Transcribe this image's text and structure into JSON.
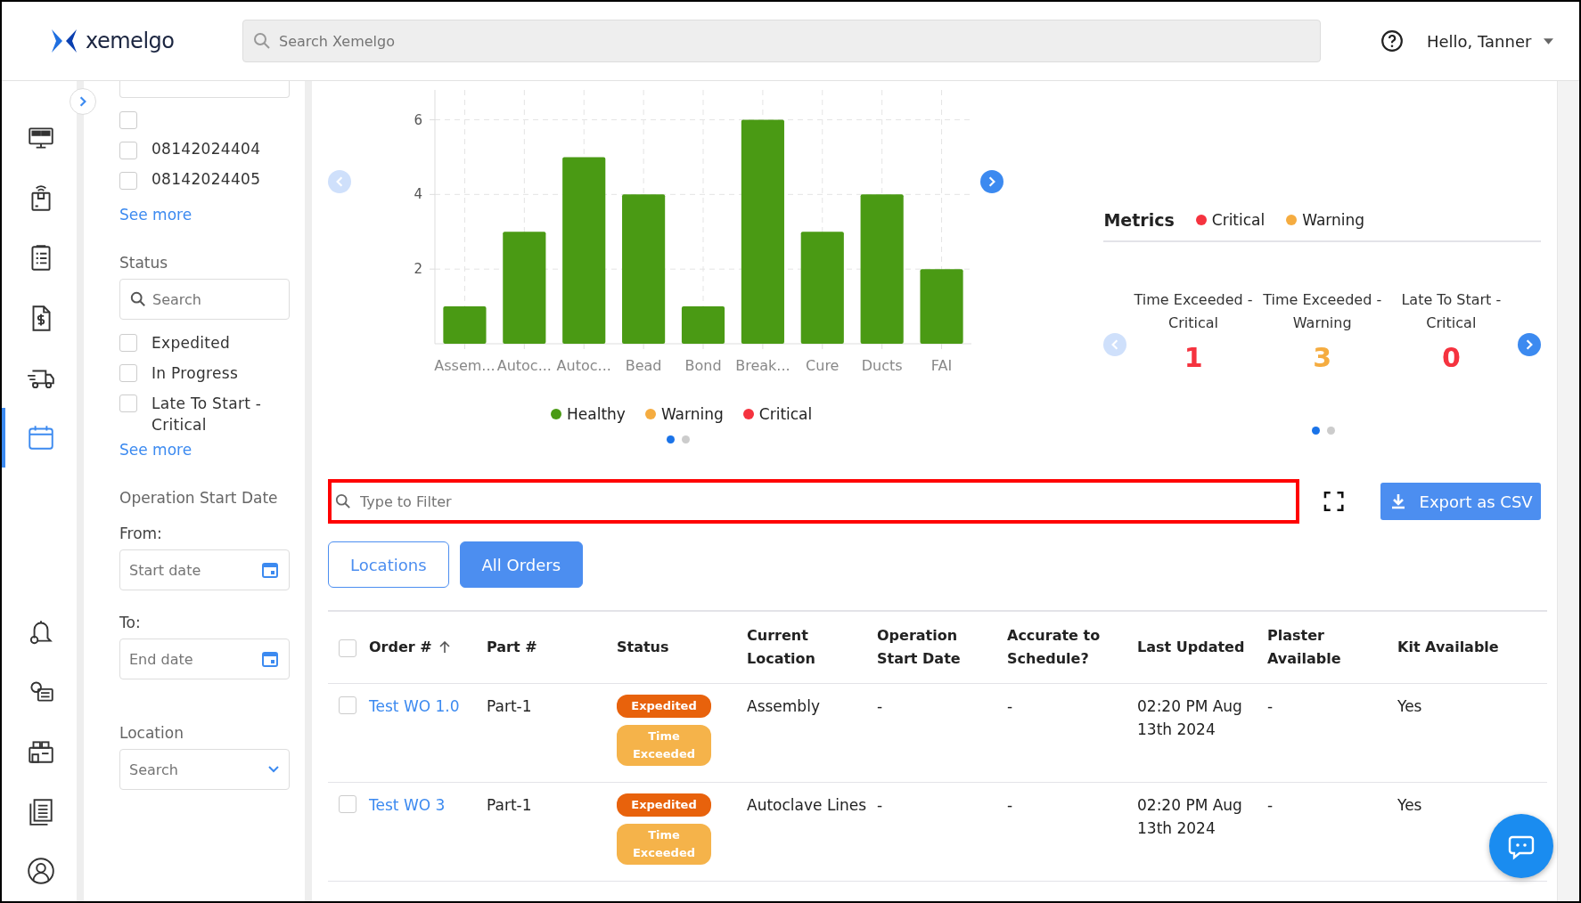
{
  "header": {
    "logo": "xemelgo",
    "search": {
      "placeholder": "Search Xemelgo"
    },
    "greeting": "Hello, Tanner"
  },
  "nav": [
    {
      "selected": false
    },
    {
      "selected": false
    },
    {
      "selected": false
    },
    {
      "selected": false
    },
    {
      "selected": false
    },
    {
      "selected": true
    },
    {
      "selected": false
    },
    {
      "selected": false
    },
    {
      "selected": false
    },
    {
      "selected": false
    },
    {
      "selected": false
    }
  ],
  "filters": {
    "order_options": [
      {
        "checked": false
      },
      {
        "label": "08142024404",
        "checked": false
      },
      {
        "label": "08142024405",
        "checked": false
      }
    ],
    "order_see_more": "See more",
    "status": {
      "title": "Status",
      "search_placeholder": "Search",
      "options": [
        {
          "label": "Expedited",
          "checked": false
        },
        {
          "label": "In Progress",
          "checked": false
        },
        {
          "label": "Late To Start - Critical",
          "checked": false
        }
      ],
      "see_more": "See more"
    },
    "date": {
      "title": "Operation Start Date",
      "from_label": "From:",
      "from_placeholder": "Start date",
      "to_label": "To:",
      "to_placeholder": "End date"
    },
    "location": {
      "title": "Location",
      "placeholder": "Search"
    }
  },
  "chart": {
    "chart_data": {
      "type": "bar",
      "grid": true,
      "categories": [
        "Assem...",
        "Autoc...",
        "Autoc...",
        "Bead",
        "Bond",
        "Break...",
        "Cure",
        "Ducts",
        "FAI"
      ],
      "series": [
        {
          "name": "Healthy",
          "color": "#4a9a14",
          "values": [
            1,
            3,
            5,
            4,
            1,
            6,
            3,
            4,
            2
          ]
        },
        {
          "name": "Warning",
          "color": "#f5ac40",
          "values": [
            0,
            0,
            0,
            0,
            0,
            0,
            0,
            0,
            0
          ]
        },
        {
          "name": "Critical",
          "color": "#f5333f",
          "values": [
            0,
            0,
            0,
            0,
            0,
            0,
            0,
            0,
            0
          ]
        }
      ],
      "ylim": [
        0,
        6.8
      ],
      "yticks": [
        2,
        4,
        6
      ]
    },
    "pages": [
      {
        "selected": true
      },
      {
        "selected": false
      }
    ]
  },
  "metrics": {
    "title": "Metrics",
    "legend": [
      {
        "label": "Critical",
        "color": "#f5333f"
      },
      {
        "label": "Warning",
        "color": "#f5ac40"
      }
    ],
    "cards": [
      {
        "label": "Time Exceeded - Critical",
        "value": "1",
        "color": "#f5333f"
      },
      {
        "label": "Time Exceeded - Warning",
        "value": "3",
        "color": "#f5ac40"
      },
      {
        "label": "Late To Start - Critical",
        "value": "0",
        "color": "#f5333f"
      }
    ],
    "pages": [
      {
        "selected": true
      },
      {
        "selected": false
      }
    ]
  },
  "filter_field": {
    "placeholder": "Type to Filter"
  },
  "export_button": "Export as CSV",
  "tabs": [
    {
      "label": "Locations",
      "selected": false
    },
    {
      "label": "All Orders",
      "selected": true
    }
  ],
  "table": {
    "select_all_checked": false,
    "columns": [
      "Order #",
      "Part #",
      "Status",
      "Current Location",
      "Operation Start Date",
      "Accurate to Schedule?",
      "Last Updated",
      "Plaster Available",
      "Kit Available"
    ],
    "rows": [
      {
        "checked": false,
        "order": "Test WO 1.0",
        "part": "Part-1",
        "badges": [
          {
            "label": "Expedited",
            "color": "#e8620c"
          },
          {
            "label": "Time Exceeded",
            "color": "#f5b34a"
          }
        ],
        "location": "Assembly",
        "start": "-",
        "accurate": "-",
        "updated": "02:20 PM Aug 13th 2024",
        "plaster": "-",
        "kit": "Yes"
      },
      {
        "checked": false,
        "order": "Test WO 3",
        "part": "Part-1",
        "badges": [
          {
            "label": "Expedited",
            "color": "#e8620c"
          },
          {
            "label": "Time Exceeded",
            "color": "#f5b34a"
          }
        ],
        "location": "Autoclave Lines",
        "start": "-",
        "accurate": "-",
        "updated": "02:20 PM Aug 13th 2024",
        "plaster": "-",
        "kit": "Yes"
      }
    ]
  }
}
